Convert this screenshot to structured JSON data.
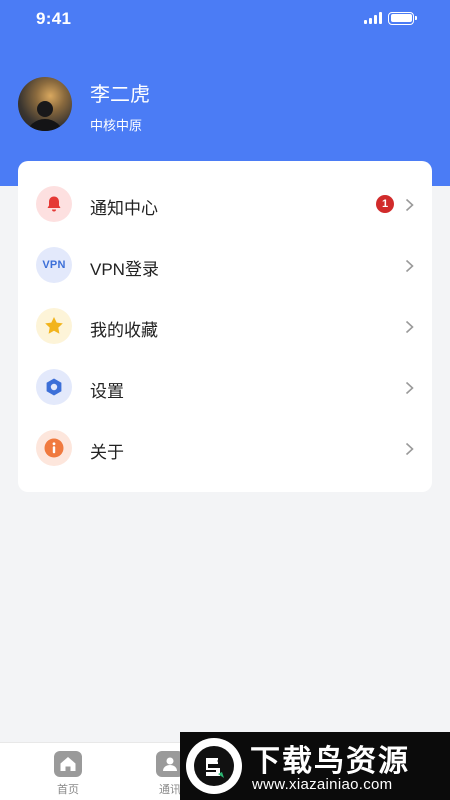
{
  "status_bar": {
    "time": "9:41"
  },
  "profile": {
    "name": "李二虎",
    "org": "中核中原"
  },
  "menu": [
    {
      "label": "通知中心",
      "icon": "bell-icon",
      "badge": "1",
      "icon_bg": "#fde0e0",
      "icon_color": "#e53935"
    },
    {
      "label": "VPN登录",
      "icon": "vpn-icon",
      "icon_text": "VPN",
      "icon_bg": "#e3e9fb",
      "icon_color": "#3c6fd8"
    },
    {
      "label": "我的收藏",
      "icon": "star-icon",
      "icon_bg": "#fdf4d8",
      "icon_color": "#f2b41c"
    },
    {
      "label": "设置",
      "icon": "settings-icon",
      "icon_bg": "#e3e9fb",
      "icon_color": "#3c6fd8"
    },
    {
      "label": "关于",
      "icon": "info-icon",
      "icon_bg": "#fde6dc",
      "icon_color": "#f07a3f"
    }
  ],
  "tabbar": [
    {
      "label": "首页",
      "icon": "home-icon"
    },
    {
      "label": "通讯",
      "icon": "contacts-icon"
    }
  ],
  "watermark": {
    "title": "下载鸟资源",
    "url": "www.xiazainiao.com"
  },
  "colors": {
    "header": "#4b7cf5",
    "badge": "#d12b2b"
  }
}
